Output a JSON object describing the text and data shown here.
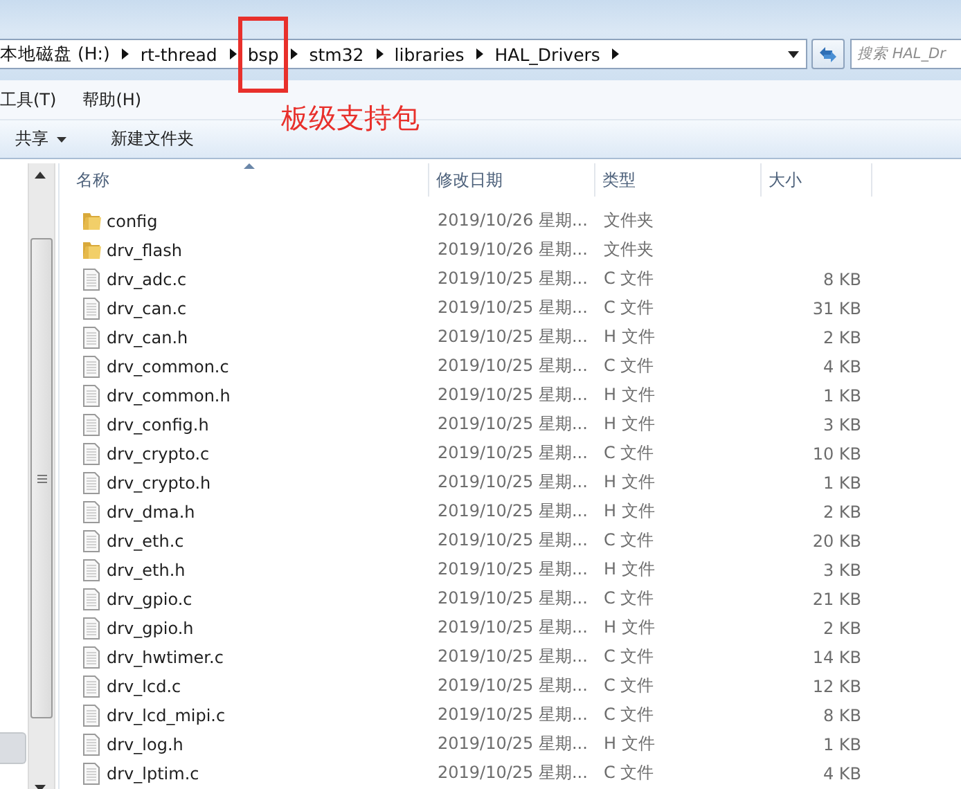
{
  "address_bar": {
    "crumbs": [
      {
        "label": "本地磁盘 (H:)",
        "highlighted": false
      },
      {
        "label": "rt-thread",
        "highlighted": false
      },
      {
        "label": "bsp",
        "highlighted": true
      },
      {
        "label": "stm32",
        "highlighted": false
      },
      {
        "label": "libraries",
        "highlighted": false
      },
      {
        "label": "HAL_Drivers",
        "highlighted": false
      }
    ]
  },
  "search": {
    "placeholder": "搜索 HAL_Dr"
  },
  "annotation": {
    "label": "板级支持包"
  },
  "menu": [
    "工具(T)",
    "帮助(H)"
  ],
  "toolbar": [
    {
      "label": "共享",
      "kind": "dropdown"
    },
    {
      "label": "新建文件夹",
      "kind": "plain"
    }
  ],
  "columns": [
    {
      "label": "名称",
      "sorted": true
    },
    {
      "label": "修改日期",
      "sorted": false
    },
    {
      "label": "类型",
      "sorted": false
    },
    {
      "label": "大小",
      "sorted": false
    }
  ],
  "files": [
    {
      "name": "config",
      "kind": "folder",
      "date": "2019/10/26 星期...",
      "type": "文件夹"
    },
    {
      "name": "drv_flash",
      "kind": "folder",
      "date": "2019/10/26 星期...",
      "type": "文件夹"
    },
    {
      "name": "drv_adc.c",
      "kind": "file",
      "date": "2019/10/25 星期...",
      "type": "C 文件",
      "size": "8 KB"
    },
    {
      "name": "drv_can.c",
      "kind": "file",
      "date": "2019/10/25 星期...",
      "type": "C 文件",
      "size": "31 KB"
    },
    {
      "name": "drv_can.h",
      "kind": "file",
      "date": "2019/10/25 星期...",
      "type": "H 文件",
      "size": "2 KB"
    },
    {
      "name": "drv_common.c",
      "kind": "file",
      "date": "2019/10/25 星期...",
      "type": "C 文件",
      "size": "4 KB"
    },
    {
      "name": "drv_common.h",
      "kind": "file",
      "date": "2019/10/25 星期...",
      "type": "H 文件",
      "size": "1 KB"
    },
    {
      "name": "drv_config.h",
      "kind": "file",
      "date": "2019/10/25 星期...",
      "type": "H 文件",
      "size": "3 KB"
    },
    {
      "name": "drv_crypto.c",
      "kind": "file",
      "date": "2019/10/25 星期...",
      "type": "C 文件",
      "size": "10 KB"
    },
    {
      "name": "drv_crypto.h",
      "kind": "file",
      "date": "2019/10/25 星期...",
      "type": "H 文件",
      "size": "1 KB"
    },
    {
      "name": "drv_dma.h",
      "kind": "file",
      "date": "2019/10/25 星期...",
      "type": "H 文件",
      "size": "2 KB"
    },
    {
      "name": "drv_eth.c",
      "kind": "file",
      "date": "2019/10/25 星期...",
      "type": "C 文件",
      "size": "20 KB"
    },
    {
      "name": "drv_eth.h",
      "kind": "file",
      "date": "2019/10/25 星期...",
      "type": "H 文件",
      "size": "3 KB"
    },
    {
      "name": "drv_gpio.c",
      "kind": "file",
      "date": "2019/10/25 星期...",
      "type": "C 文件",
      "size": "21 KB"
    },
    {
      "name": "drv_gpio.h",
      "kind": "file",
      "date": "2019/10/25 星期...",
      "type": "H 文件",
      "size": "2 KB"
    },
    {
      "name": "drv_hwtimer.c",
      "kind": "file",
      "date": "2019/10/25 星期...",
      "type": "C 文件",
      "size": "14 KB"
    },
    {
      "name": "drv_lcd.c",
      "kind": "file",
      "date": "2019/10/25 星期...",
      "type": "C 文件",
      "size": "12 KB"
    },
    {
      "name": "drv_lcd_mipi.c",
      "kind": "file",
      "date": "2019/10/25 星期...",
      "type": "C 文件",
      "size": "8 KB"
    },
    {
      "name": "drv_log.h",
      "kind": "file",
      "date": "2019/10/25 星期...",
      "type": "H 文件",
      "size": "1 KB"
    },
    {
      "name": "drv_lptim.c",
      "kind": "file",
      "date": "2019/10/25 星期...",
      "type": "C 文件",
      "size": "4 KB"
    }
  ]
}
